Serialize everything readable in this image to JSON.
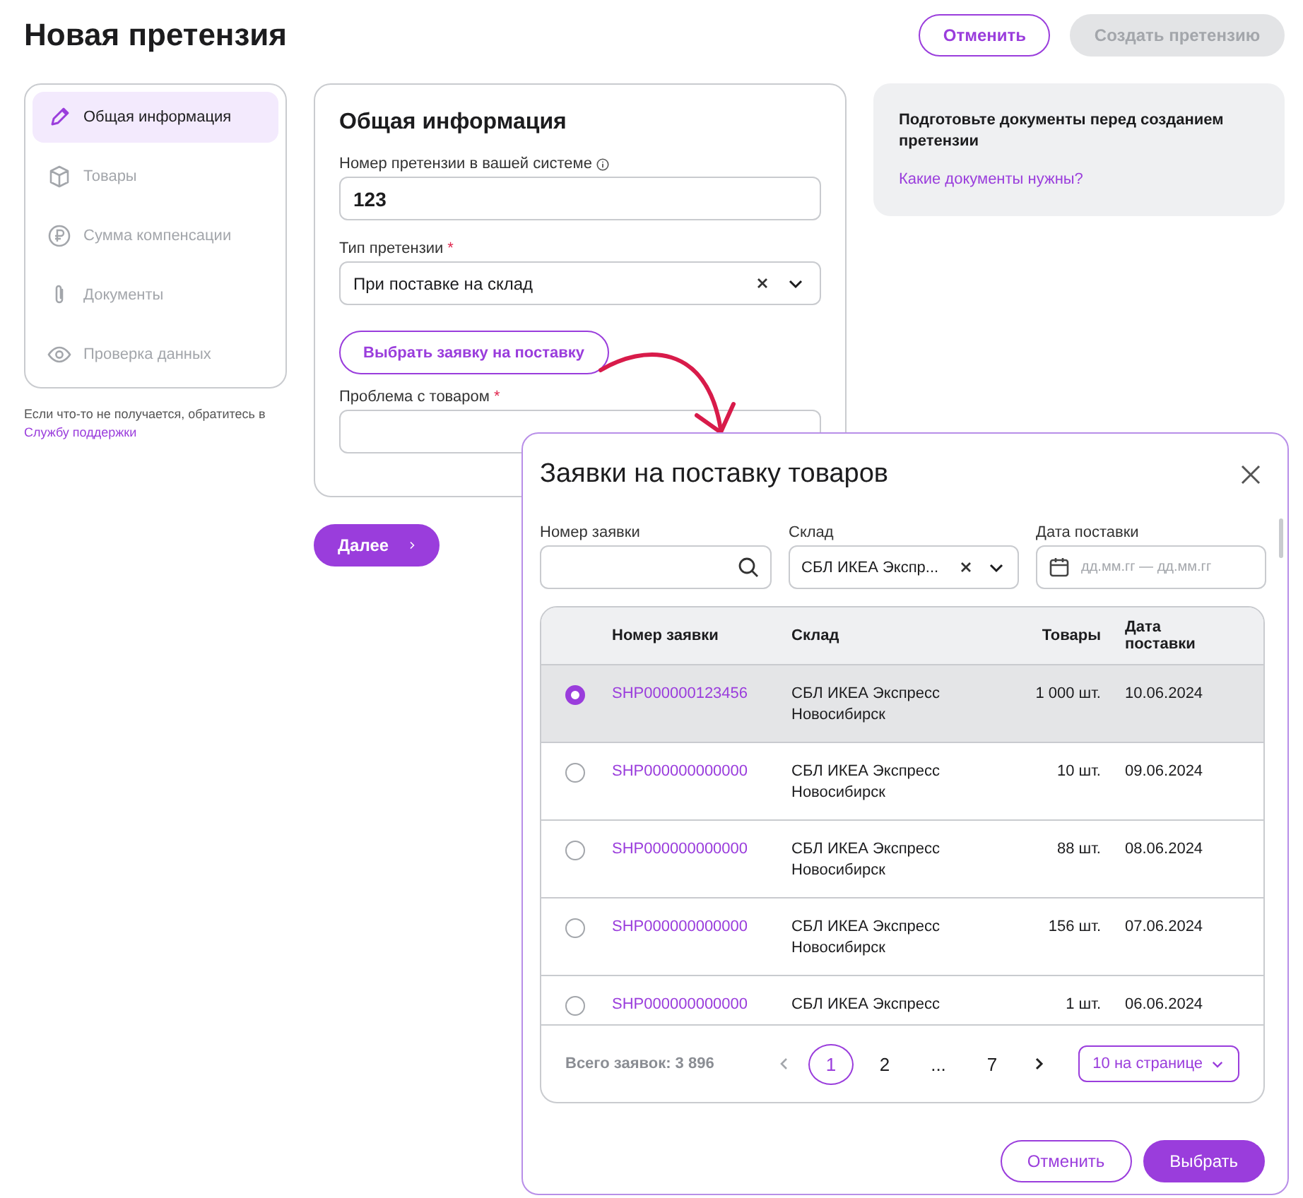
{
  "page": {
    "title": "Новая претензия",
    "actions": [
      {
        "label": "Отменить",
        "disabled": false
      },
      {
        "label": "Создать претензию",
        "disabled": true
      }
    ]
  },
  "steps": [
    {
      "label": "Общая информация",
      "selected": true
    },
    {
      "label": "Товары",
      "selected": false
    },
    {
      "label": "Сумма компенсации",
      "selected": false
    },
    {
      "label": "Документы",
      "selected": false
    },
    {
      "label": "Проверка данных",
      "selected": false
    }
  ],
  "help": {
    "text": "Если что-то не получается, обратитесь в",
    "link": "Службу поддержки"
  },
  "form": {
    "title": "Общая информация",
    "fields": [
      {
        "kind": "text",
        "label": "Номер претензии в вашей системе",
        "hint_icon": true,
        "value": "123"
      },
      {
        "kind": "select",
        "label": "Тип претензии",
        "hint_icon": false,
        "required_mark": "*",
        "value": "При поставке на склад"
      },
      {
        "kind": "button",
        "label": "Выбрать заявку на поставку"
      },
      {
        "kind": "text",
        "label": "Проблема с товаром",
        "hint_icon": false,
        "required_mark": "*"
      }
    ]
  },
  "next_button": "Далее",
  "notice": {
    "text": "Подготовьте документы перед созданием претензии",
    "link": "Какие документы нужны?"
  },
  "dialog": {
    "title": "Заявки на поставку товаров",
    "filters": [
      {
        "kind": "search",
        "label": "Номер заявки"
      },
      {
        "kind": "select",
        "label": "Склад",
        "value": "СБЛ ИКЕА Экспр..."
      },
      {
        "kind": "date",
        "label": "Дата поставки",
        "placeholder": "дд.мм.гг — дд.мм.гг"
      }
    ],
    "table": {
      "columns": [
        "Номер заявки",
        "Склад",
        "Товары",
        "Дата поставки"
      ],
      "rows": [
        {
          "selected": true,
          "number": "SHP000000123456",
          "warehouse": "СБЛ ИКЕА Экспресс Новосибирск",
          "items": "1 000 шт.",
          "date": "10.06.2024"
        },
        {
          "selected": false,
          "number": "SHP000000000000",
          "warehouse": "СБЛ ИКЕА Экспресс Новосибирск",
          "items": "10 шт.",
          "date": "09.06.2024"
        },
        {
          "selected": false,
          "number": "SHP000000000000",
          "warehouse": "СБЛ ИКЕА Экспресс Новосибирск",
          "items": "88 шт.",
          "date": "08.06.2024"
        },
        {
          "selected": false,
          "number": "SHP000000000000",
          "warehouse": "СБЛ ИКЕА Экспресс Новосибирск",
          "items": "156 шт.",
          "date": "07.06.2024"
        },
        {
          "selected": false,
          "number": "SHP000000000000",
          "warehouse": "СБЛ ИКЕА Экспресс",
          "items": "1 шт.",
          "date": "06.06.2024"
        }
      ]
    },
    "pagination": {
      "total": "Всего заявок: 3 896",
      "pages": [
        {
          "label": "1",
          "selected": true
        },
        {
          "label": "2",
          "selected": false
        },
        {
          "label": "...",
          "selected": false
        },
        {
          "label": "7",
          "selected": false
        }
      ],
      "page_size": "10 на странице"
    },
    "buttons": [
      {
        "kind": "secondary",
        "label": "Отменить"
      },
      {
        "kind": "primary",
        "label": "Выбрать"
      }
    ]
  }
}
